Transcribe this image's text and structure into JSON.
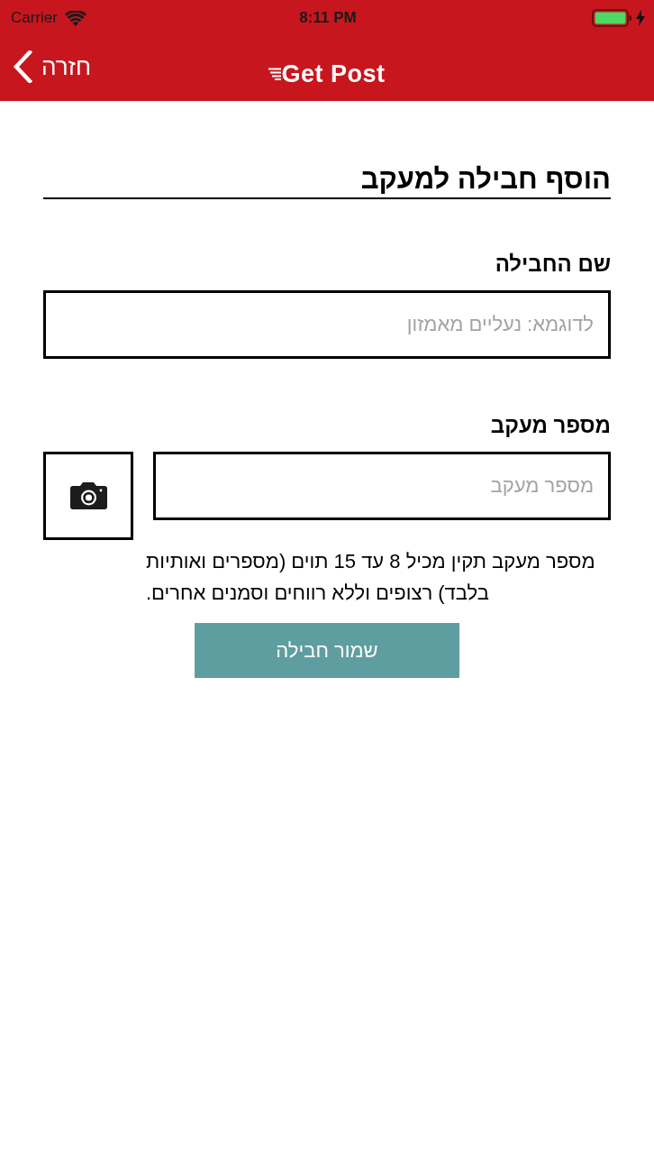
{
  "status_bar": {
    "carrier": "Carrier",
    "time": "8:11 PM",
    "charging": true
  },
  "nav_bar": {
    "back_label": "חזרה",
    "logo": "Get Post"
  },
  "form": {
    "title": "הוסף חבילה למעקב",
    "fields": [
      {
        "kind": "text",
        "label": "שם החבילה",
        "placeholder": "לדוגמא: נעליים מאמזון"
      },
      {
        "kind": "scan",
        "label": "מספר מעקב",
        "placeholder": "מספר מעקב",
        "hint": "מספר מעקב תקין מכיל 8 עד 15 תוים (מספרים ואותיות בלבד) רצופים וללא רווחים וסמנים אחרים."
      }
    ],
    "submit": "שמור חבילה"
  }
}
